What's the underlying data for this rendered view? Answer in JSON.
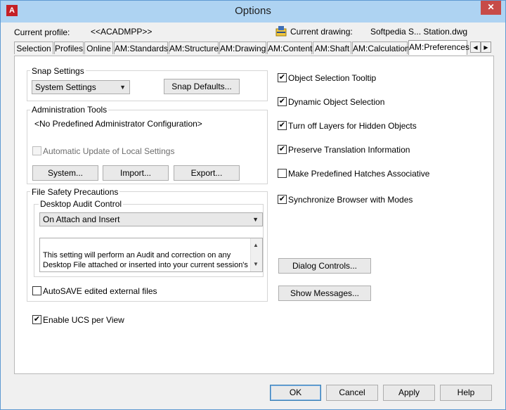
{
  "window": {
    "title": "Options"
  },
  "header": {
    "current_profile_label": "Current profile:",
    "current_profile_value": "<<ACADMPP>>",
    "current_drawing_label": "Current drawing:",
    "current_drawing_value": "Softpedia S... Station.dwg"
  },
  "tabs": [
    {
      "label": "Selection"
    },
    {
      "label": "Profiles"
    },
    {
      "label": "Online"
    },
    {
      "label": "AM:Standards"
    },
    {
      "label": "AM:Structure"
    },
    {
      "label": "AM:Drawing"
    },
    {
      "label": "AM:Content"
    },
    {
      "label": "AM:Shaft"
    },
    {
      "label": "AM:Calculation"
    },
    {
      "label": "AM:Preferences",
      "active": true
    }
  ],
  "snap": {
    "title": "Snap Settings",
    "combo_value": "System Settings",
    "defaults_button": "Snap Defaults..."
  },
  "admin": {
    "title": "Administration Tools",
    "config_text": "<No Predefined Administrator Configuration>",
    "auto_update_label": "Automatic Update of Local Settings",
    "system_button": "System...",
    "import_button": "Import...",
    "export_button": "Export..."
  },
  "file_safety": {
    "title": "File Safety Precautions",
    "audit_title": "Desktop Audit Control",
    "audit_combo_value": "On Attach and Insert",
    "audit_description": "This setting will perform an Audit and correction on any\nDesktop File attached or inserted into your current session's\n.dwg file.  This option provides the best compromise",
    "autosave_label": "AutoSAVE edited external files"
  },
  "enable_ucs_label": "Enable UCS per View",
  "right_options": [
    {
      "label": "Object Selection Tooltip",
      "checked": true
    },
    {
      "label": "Dynamic Object Selection",
      "checked": true
    },
    {
      "label": "Turn off Layers for Hidden Objects",
      "checked": true
    },
    {
      "label": "Preserve Translation Information",
      "checked": true
    },
    {
      "label": "Make Predefined Hatches Associative",
      "checked": false
    },
    {
      "label": "Synchronize Browser with Modes",
      "checked": true
    }
  ],
  "dialog_controls_button": "Dialog Controls...",
  "show_messages_button": "Show Messages...",
  "footer": {
    "ok": "OK",
    "cancel": "Cancel",
    "apply": "Apply",
    "help": "Help"
  },
  "icons": {
    "app": "autocad-logo-icon",
    "drawing": "drawing-file-icon",
    "check": "✔"
  }
}
